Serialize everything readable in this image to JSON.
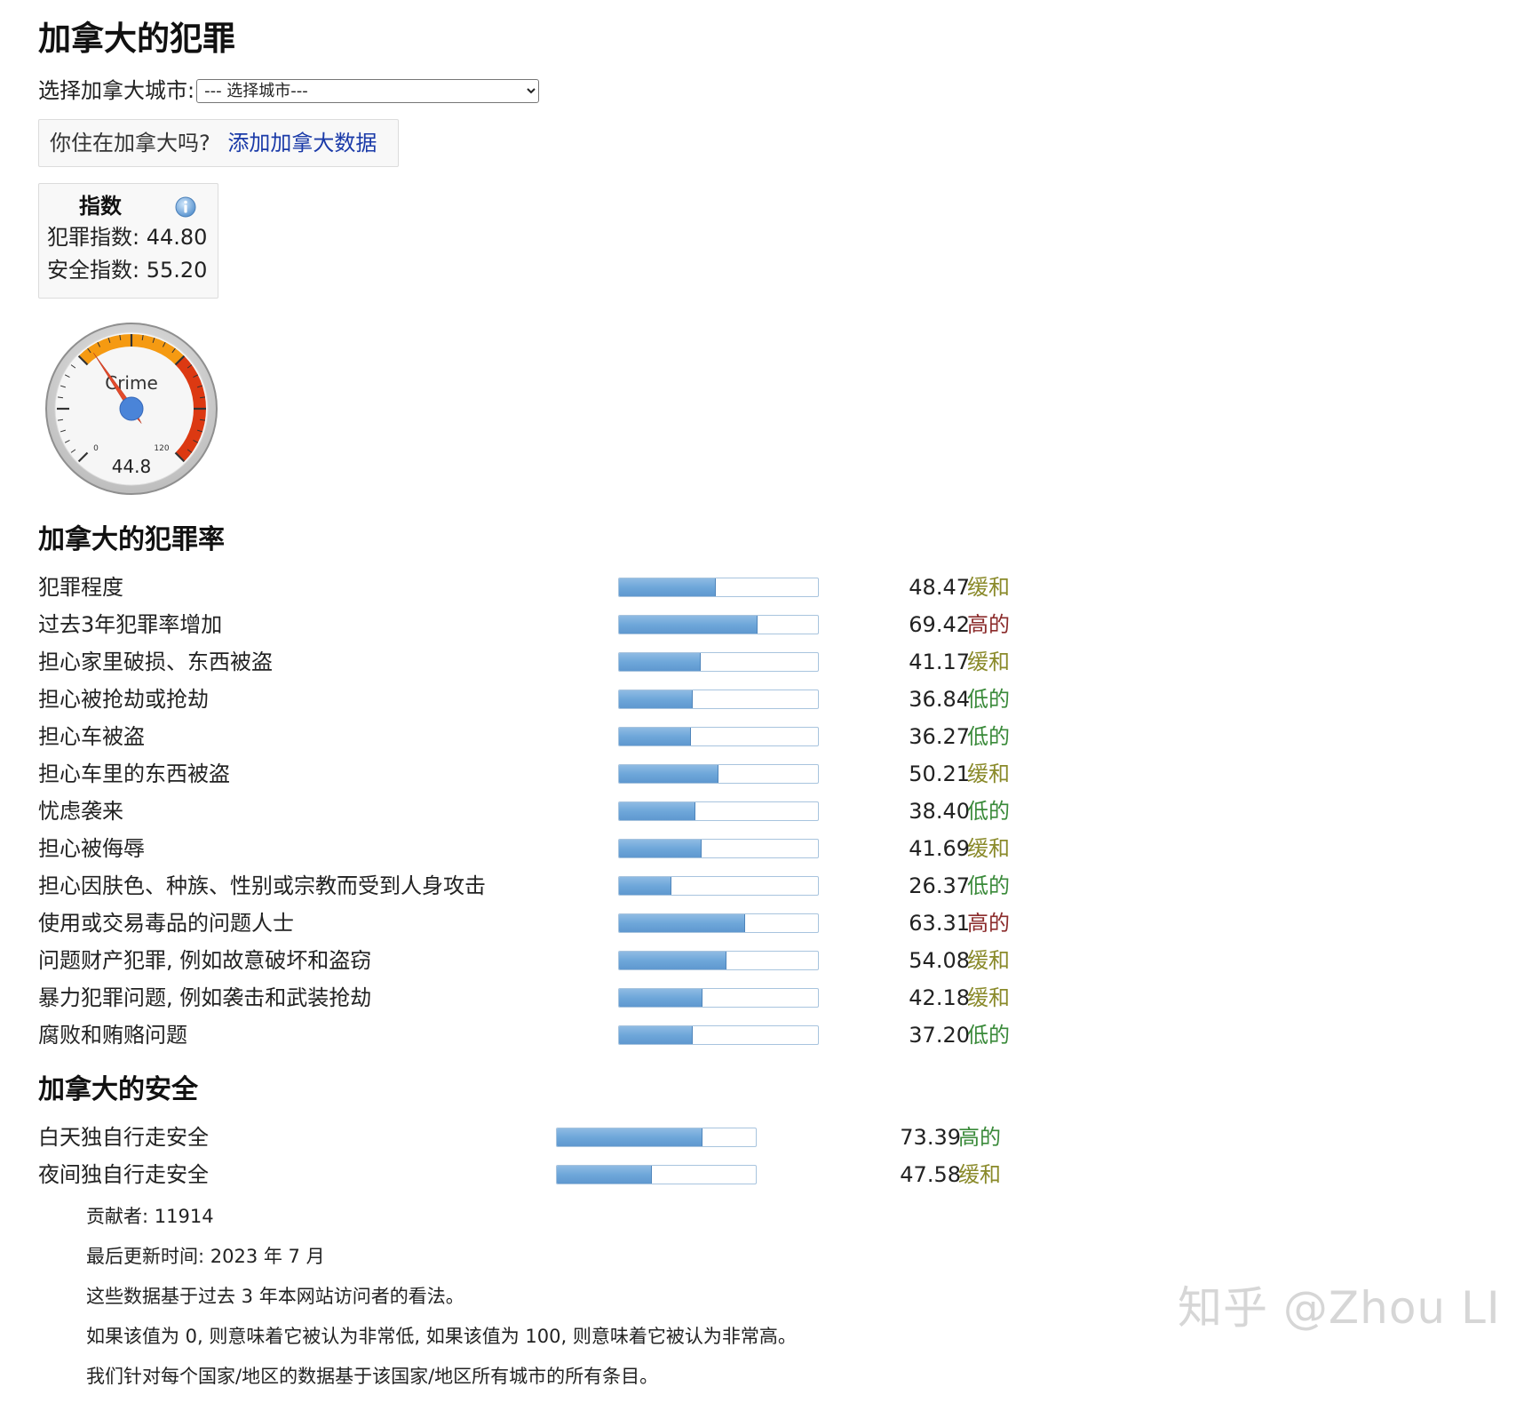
{
  "title": "加拿大的犯罪",
  "city_select": {
    "label": "选择加拿大城市:",
    "selected": "--- 选择城市---"
  },
  "live_prompt": {
    "question": "你住在加拿大吗?",
    "link": "添加加拿大数据"
  },
  "index_box": {
    "title": "指数",
    "info_icon": "info-icon",
    "crime_index_text": "犯罪指数: 44.80",
    "safety_index_text": "安全指数: 55.20"
  },
  "gauge": {
    "label": "Crime",
    "value": 44.8,
    "value_text": "44.8",
    "min_text": "0",
    "max_text": "120",
    "min": 0,
    "max": 120
  },
  "crime_section": {
    "title": "加拿大的犯罪率",
    "rows": [
      {
        "label": "犯罪程度",
        "value": 48.47,
        "value_text": "48.47",
        "level": "缓和",
        "level_color": "#8a8a2a"
      },
      {
        "label": "过去3年犯罪率增加",
        "value": 69.42,
        "value_text": "69.42",
        "level": "高的",
        "level_color": "#8b2b2b"
      },
      {
        "label": "担心家里破损、东西被盗",
        "value": 41.17,
        "value_text": "41.17",
        "level": "缓和",
        "level_color": "#8a8a2a"
      },
      {
        "label": "担心被抢劫或抢劫",
        "value": 36.84,
        "value_text": "36.84",
        "level": "低的",
        "level_color": "#3a8a3a"
      },
      {
        "label": "担心车被盗",
        "value": 36.27,
        "value_text": "36.27",
        "level": "低的",
        "level_color": "#3a8a3a"
      },
      {
        "label": "担心车里的东西被盗",
        "value": 50.21,
        "value_text": "50.21",
        "level": "缓和",
        "level_color": "#8a8a2a"
      },
      {
        "label": "忧虑袭来",
        "value": 38.4,
        "value_text": "38.40",
        "level": "低的",
        "level_color": "#3a8a3a"
      },
      {
        "label": "担心被侮辱",
        "value": 41.69,
        "value_text": "41.69",
        "level": "缓和",
        "level_color": "#8a8a2a"
      },
      {
        "label": "担心因肤色、种族、性别或宗教而受到人身攻击",
        "value": 26.37,
        "value_text": "26.37",
        "level": "低的",
        "level_color": "#3a8a3a"
      },
      {
        "label": "使用或交易毒品的问题人士",
        "value": 63.31,
        "value_text": "63.31",
        "level": "高的",
        "level_color": "#8b2b2b"
      },
      {
        "label": "问题财产犯罪, 例如故意破坏和盗窃",
        "value": 54.08,
        "value_text": "54.08",
        "level": "缓和",
        "level_color": "#8a8a2a"
      },
      {
        "label": "暴力犯罪问题, 例如袭击和武装抢劫",
        "value": 42.18,
        "value_text": "42.18",
        "level": "缓和",
        "level_color": "#8a8a2a"
      },
      {
        "label": "腐败和贿赂问题",
        "value": 37.2,
        "value_text": "37.20",
        "level": "低的",
        "level_color": "#3a8a3a"
      }
    ]
  },
  "safety_section": {
    "title": "加拿大的安全",
    "rows": [
      {
        "label": "白天独自行走安全",
        "value": 73.39,
        "value_text": "73.39",
        "level": "高的",
        "level_color": "#3a8a3a"
      },
      {
        "label": "夜间独自行走安全",
        "value": 47.58,
        "value_text": "47.58",
        "level": "缓和",
        "level_color": "#8a8a2a"
      }
    ]
  },
  "notes": [
    "贡献者: 11914",
    "最后更新时间: 2023 年 7 月",
    "这些数据基于过去 3 年本网站访问者的看法。",
    "如果该值为 0, 则意味着它被认为非常低, 如果该值为 100, 则意味着它被认为非常高。",
    "我们针对每个国家/地区的数据基于该国家/地区所有城市的所有条目。"
  ],
  "watermark": "知乎 @Zhou LI"
}
